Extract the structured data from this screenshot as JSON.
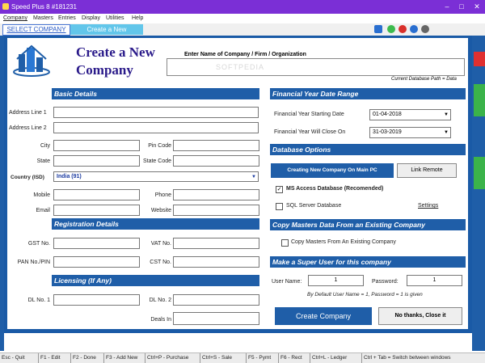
{
  "window": {
    "title": "Speed Plus 8 #181231"
  },
  "menu": [
    "Company",
    "Masters",
    "Entries",
    "Display",
    "Utilities",
    "Help"
  ],
  "toolbar": {
    "select_company": "SELECT COMPANY",
    "create_new": "Create a New"
  },
  "dialog": {
    "heading_line1": "Create a New",
    "heading_line2": "Company",
    "name_label": "Enter Name of Company / Firm / Organization",
    "name_value": "",
    "db_path": "Current Database Path = Data",
    "watermark": "SOFTPEDIA"
  },
  "basic": {
    "header": "Basic Details",
    "address1": "Address Line 1",
    "address2": "Address Line 2",
    "city": "City",
    "pin": "Pin Code",
    "state": "State",
    "state_code": "State Code",
    "country_label": "Country (ISD)",
    "country_value": "India  (91)",
    "mobile": "Mobile",
    "phone": "Phone",
    "email": "Email",
    "website": "Website"
  },
  "registration": {
    "header": "Registration Details",
    "gst": "GST No.",
    "vat": "VAT No.",
    "pan": "PAN No./PIN",
    "cst": "CST No."
  },
  "licensing": {
    "header": "Licensing (If Any)",
    "dl1": "DL No. 1",
    "dl2": "DL No. 2",
    "deals": "Deals In"
  },
  "financial": {
    "header": "Financial Year Date Range",
    "start_label": "Financial Year Starting Date",
    "start_value": "01-04-2018",
    "close_label": "Financial Year Will Close On",
    "close_value": "31-03-2019"
  },
  "database": {
    "header": "Database Options",
    "main_pc": "Creating New Company On Main PC",
    "link_remote": "Link Remote",
    "ms_access": "MS Access Database   (Recomended)",
    "ms_access_checked": true,
    "sql_server": "SQL Server Database",
    "sql_checked": false,
    "settings": "Settings"
  },
  "copy_masters": {
    "header": "Copy Masters Data From an Existing Company",
    "checkbox": "Copy Masters From An Existing Company"
  },
  "super_user": {
    "header": "Make a Super User for this company",
    "user_label": "User Name:",
    "user_value": "1",
    "password_label": "Password:",
    "password_value": "1",
    "note": "By Default User Name = 1,  Password = 1 is given"
  },
  "actions": {
    "create": "Create Company",
    "close": "No thanks, Close it"
  },
  "status": [
    "Esc - Quit",
    "F1 - Edit",
    "F2 - Done",
    "F3 - Add New",
    "Ctrl+P - Purchase",
    "Ctrl+S - Sale",
    "F5 - Pymt",
    "F6 - Rect",
    "Ctrl+L - Ledger",
    "Ctrl + Tab = Switch between windows"
  ],
  "colors": {
    "titlebar": "#7b2fd6",
    "section_header": "#1f5ea8",
    "primary_button": "#1f5ea8",
    "heading_text": "#2a1a8a"
  }
}
